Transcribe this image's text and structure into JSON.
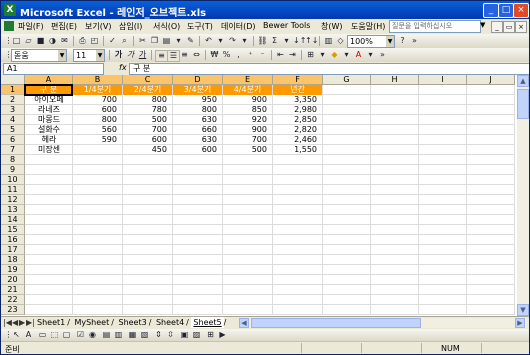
{
  "window": {
    "title": "Microsoft Excel - 레인저_오브젝트.xls",
    "app_icon": "X",
    "minimize": "_",
    "maximize": "□",
    "close": "×"
  },
  "menu": {
    "items": [
      "파일(F)",
      "편집(E)",
      "보기(V)",
      "삽입(I)",
      "서식(O)",
      "도구(T)",
      "데이터(D)",
      "Bewer Tools",
      "창(W)",
      "도움말(H)"
    ],
    "help_placeholder": "질문을 입력하십시오"
  },
  "standard_toolbar": {
    "zoom": "100%",
    "autosum": "Σ",
    "sort_asc": "↓↑",
    "sort_desc": "↑↓"
  },
  "format_toolbar": {
    "font": "돋움",
    "size": "11",
    "bold": "가",
    "italic": "가",
    "underline": "가",
    "currency": "₩",
    "percent": "%",
    "comma": ","
  },
  "formula_bar": {
    "name_box": "A1",
    "fx": "fx",
    "content": "구 분"
  },
  "columns": [
    "A",
    "B",
    "C",
    "D",
    "E",
    "F",
    "G",
    "H",
    "I",
    "J"
  ],
  "rows": [
    "1",
    "2",
    "3",
    "4",
    "5",
    "6",
    "7",
    "8",
    "9",
    "10",
    "11",
    "12",
    "13",
    "14",
    "15",
    "16",
    "17",
    "18",
    "19",
    "20",
    "21",
    "22",
    "23"
  ],
  "sheet": {
    "header": [
      "구 분",
      "1/4분기",
      "2/4분기",
      "3/4분기",
      "4/4분기",
      "년간"
    ],
    "data": [
      [
        "아이오페",
        "700",
        "800",
        "950",
        "900",
        "3,350"
      ],
      [
        "라네즈",
        "600",
        "780",
        "800",
        "850",
        "2,980"
      ],
      [
        "마몽드",
        "800",
        "500",
        "630",
        "920",
        "2,850"
      ],
      [
        "설화수",
        "560",
        "700",
        "660",
        "900",
        "2,820"
      ],
      [
        "헤라",
        "590",
        "600",
        "630",
        "700",
        "2,460"
      ],
      [
        "미장센",
        "",
        "450",
        "600",
        "500",
        "1,550"
      ]
    ]
  },
  "sheet_tabs": [
    "Sheet1",
    "MySheet",
    "Sheet3",
    "Sheet4",
    "Sheet5"
  ],
  "active_tab": "Sheet5",
  "tab_nav": [
    "|◀",
    "◀",
    "▶",
    "▶|"
  ],
  "status": {
    "ready": "준비",
    "num": "NUM"
  },
  "colors": {
    "header_fill": "#ff9900",
    "header_text": "#ffffff",
    "selection": "#fbc46a",
    "title_bar": "#0a5fd8"
  }
}
